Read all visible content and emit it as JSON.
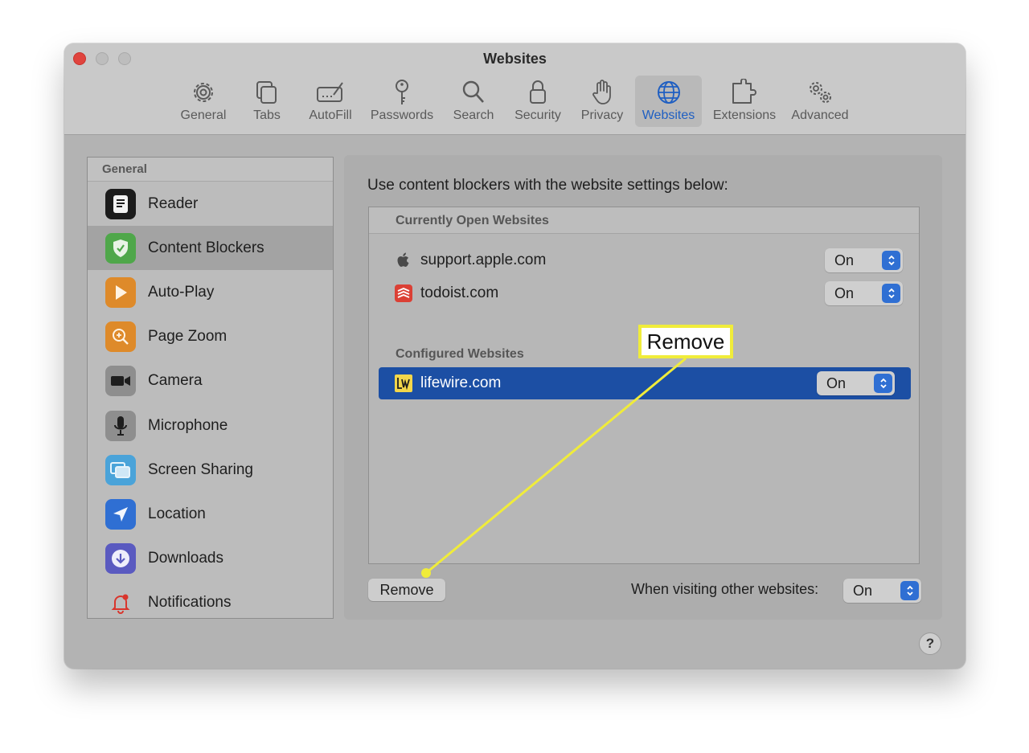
{
  "window": {
    "title": "Websites"
  },
  "toolbar": {
    "tabs": [
      {
        "label": "General",
        "icon": "gear-icon"
      },
      {
        "label": "Tabs",
        "icon": "tabs-icon"
      },
      {
        "label": "AutoFill",
        "icon": "autofill-icon"
      },
      {
        "label": "Passwords",
        "icon": "key-icon"
      },
      {
        "label": "Search",
        "icon": "magnifier-icon"
      },
      {
        "label": "Security",
        "icon": "lock-icon"
      },
      {
        "label": "Privacy",
        "icon": "hand-icon"
      },
      {
        "label": "Websites",
        "icon": "globe-icon",
        "active": true
      },
      {
        "label": "Extensions",
        "icon": "puzzle-icon"
      },
      {
        "label": "Advanced",
        "icon": "gears-icon"
      }
    ]
  },
  "sidebar": {
    "header": "General",
    "items": [
      {
        "label": "Reader",
        "icon": "reader-icon"
      },
      {
        "label": "Content Blockers",
        "icon": "shield-icon",
        "selected": true
      },
      {
        "label": "Auto-Play",
        "icon": "play-icon"
      },
      {
        "label": "Page Zoom",
        "icon": "zoom-icon"
      },
      {
        "label": "Camera",
        "icon": "camera-icon"
      },
      {
        "label": "Microphone",
        "icon": "microphone-icon"
      },
      {
        "label": "Screen Sharing",
        "icon": "screen-sharing-icon"
      },
      {
        "label": "Location",
        "icon": "location-icon"
      },
      {
        "label": "Downloads",
        "icon": "download-icon"
      },
      {
        "label": "Notifications",
        "icon": "bell-icon"
      }
    ]
  },
  "main": {
    "description": "Use content blockers with the website settings below:",
    "open_header": "Currently Open Websites",
    "open_sites": [
      {
        "domain": "support.apple.com",
        "value": "On",
        "icon": "apple-icon"
      },
      {
        "domain": "todoist.com",
        "value": "On",
        "icon": "todoist-icon"
      }
    ],
    "configured_header": "Configured Websites",
    "configured_sites": [
      {
        "domain": "lifewire.com",
        "value": "On",
        "icon": "lifewire-icon",
        "selected": true
      }
    ],
    "remove_label": "Remove",
    "other_label": "When visiting other websites:",
    "other_value": "On"
  },
  "help": {
    "label": "?"
  },
  "callout": {
    "label": "Remove",
    "color": "#f0ec3a"
  },
  "colors": {
    "accent": "#1c4fa4",
    "stepper": "#2f6fd3",
    "close": "#e0443e"
  }
}
